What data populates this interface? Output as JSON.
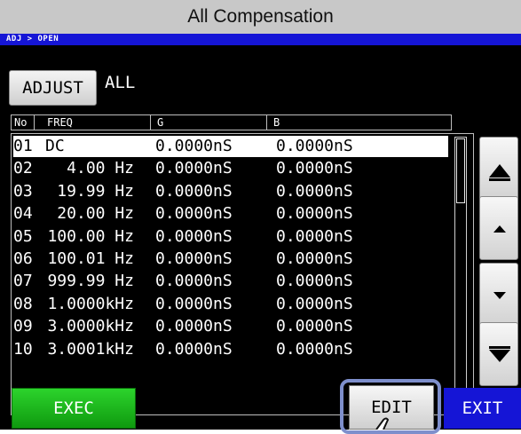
{
  "title": "All Compensation",
  "breadcrumb": "ADJ > OPEN",
  "adjust": {
    "button_label": "ADJUST",
    "value": "ALL"
  },
  "table": {
    "headers": {
      "no": "No",
      "freq": "FREQ",
      "g": "G",
      "b": "B"
    },
    "rows": [
      {
        "no": "01",
        "freq": "DC",
        "g": "0.0000nS",
        "b": "0.0000nS",
        "selected": true
      },
      {
        "no": "02",
        "freq": "4.00 Hz",
        "g": "0.0000nS",
        "b": "0.0000nS"
      },
      {
        "no": "03",
        "freq": "19.99 Hz",
        "g": "0.0000nS",
        "b": "0.0000nS"
      },
      {
        "no": "04",
        "freq": "20.00 Hz",
        "g": "0.0000nS",
        "b": "0.0000nS"
      },
      {
        "no": "05",
        "freq": "100.00 Hz",
        "g": "0.0000nS",
        "b": "0.0000nS"
      },
      {
        "no": "06",
        "freq": "100.01 Hz",
        "g": "0.0000nS",
        "b": "0.0000nS"
      },
      {
        "no": "07",
        "freq": "999.99 Hz",
        "g": "0.0000nS",
        "b": "0.0000nS"
      },
      {
        "no": "08",
        "freq": "1.0000kHz",
        "g": "0.0000nS",
        "b": "0.0000nS"
      },
      {
        "no": "09",
        "freq": "3.0000kHz",
        "g": "0.0000nS",
        "b": "0.0000nS"
      },
      {
        "no": "10",
        "freq": "3.0001kHz",
        "g": "0.0000nS",
        "b": "0.0000nS"
      }
    ]
  },
  "nav_icons": [
    "page-up-icon",
    "line-up-icon",
    "line-down-icon",
    "page-down-icon"
  ],
  "footer": {
    "exec_label": "EXEC",
    "edit_label": "EDIT",
    "exit_label": "EXIT"
  },
  "colors": {
    "screen_bg": "#000000",
    "header_blue": "#1515d6",
    "exec_green": "#1fb51f",
    "highlight_outline": "#7e8fcc",
    "title_bar": "#c8c8c8"
  }
}
